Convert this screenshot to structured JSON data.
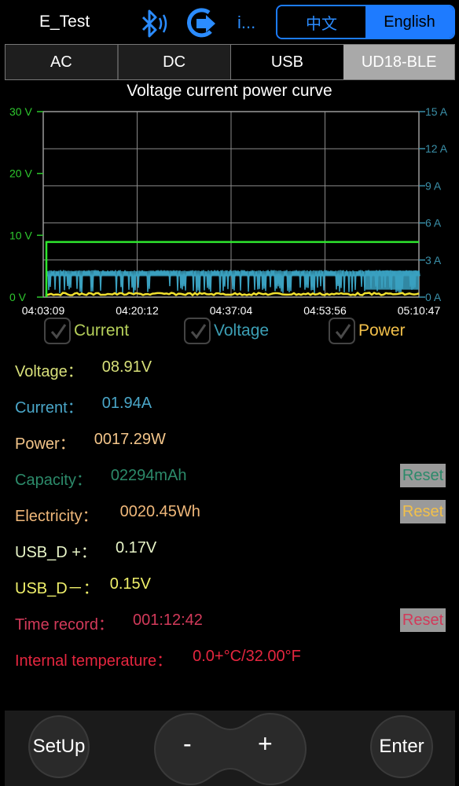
{
  "header": {
    "title": "E_Test",
    "more": "i...",
    "lang_cn": "中文",
    "lang_en": "English",
    "lang_selected": "English",
    "accent_color": "#1e7bff"
  },
  "tabs": [
    {
      "label": "AC",
      "selected": false
    },
    {
      "label": "DC",
      "selected": false
    },
    {
      "label": "USB",
      "selected": false
    },
    {
      "label": "UD18-BLE",
      "selected": true
    }
  ],
  "chart_data": {
    "type": "line",
    "title": "Voltage current power curve",
    "x_ticks": [
      "04:03:09",
      "04:20:12",
      "04:37:04",
      "04:53:56",
      "05:10:47"
    ],
    "y_left": {
      "ticks": [
        "0 V",
        "10 V",
        "20 V",
        "30 V"
      ],
      "range": [
        0,
        30
      ],
      "color": "#2ec92e"
    },
    "y_right": {
      "ticks": [
        "0 A",
        "3 A",
        "6 A",
        "9 A",
        "12 A",
        "15 A"
      ],
      "range": [
        0,
        15
      ],
      "color": "#3a8fa8"
    },
    "grid": true,
    "series": [
      {
        "name": "Voltage",
        "axis": "left",
        "color": "#2ee62e",
        "approx_value": 8.91
      },
      {
        "name": "Current",
        "axis": "right",
        "color": "#3aa0bf",
        "approx_value": 1.94
      },
      {
        "name": "Power",
        "axis": "left",
        "color": "#f0e030",
        "approx_value": 0.5
      }
    ]
  },
  "checkboxes": [
    {
      "label": "Current",
      "checked": true,
      "color": "#b5cf5a"
    },
    {
      "label": "Voltage",
      "checked": true,
      "color": "#3c9fb5"
    },
    {
      "label": "Power",
      "checked": true,
      "color": "#f2c04a"
    }
  ],
  "readings": {
    "voltage": {
      "label": "Voltage：",
      "value": "08.91V",
      "color": "#d8e07a"
    },
    "current": {
      "label": "Current：",
      "value": "01.94A",
      "color": "#4aa6c8"
    },
    "power": {
      "label": "Power：",
      "value": "0017.29W",
      "color": "#f3c58a"
    },
    "capacity": {
      "label": "Capacity：",
      "value": "02294mAh",
      "color": "#2c8a6a",
      "reset": "Reset",
      "reset_color": "#2c8a6a"
    },
    "electricity": {
      "label": "Electricity：",
      "value": "0020.45Wh",
      "color": "#f0b87a",
      "reset": "Reset",
      "reset_color": "#f2c04a"
    },
    "usb_dp": {
      "label": "USB_D +：",
      "value": "0.17V",
      "color": "#e8f5c8"
    },
    "usb_dm": {
      "label": "USB_D－：",
      "value": "0.15V",
      "color": "#f0f06a"
    },
    "time_record": {
      "label": "Time record：",
      "value": "001:12:42",
      "color": "#d23a5a",
      "reset": "Reset",
      "reset_color": "#d23a5a"
    },
    "temperature": {
      "label": "Internal temperature：",
      "value": "0.0+°C/32.00°F",
      "color": "#e5263f"
    }
  },
  "bottom": {
    "setup": "SetUp",
    "minus": "-",
    "plus": "+",
    "enter": "Enter"
  }
}
